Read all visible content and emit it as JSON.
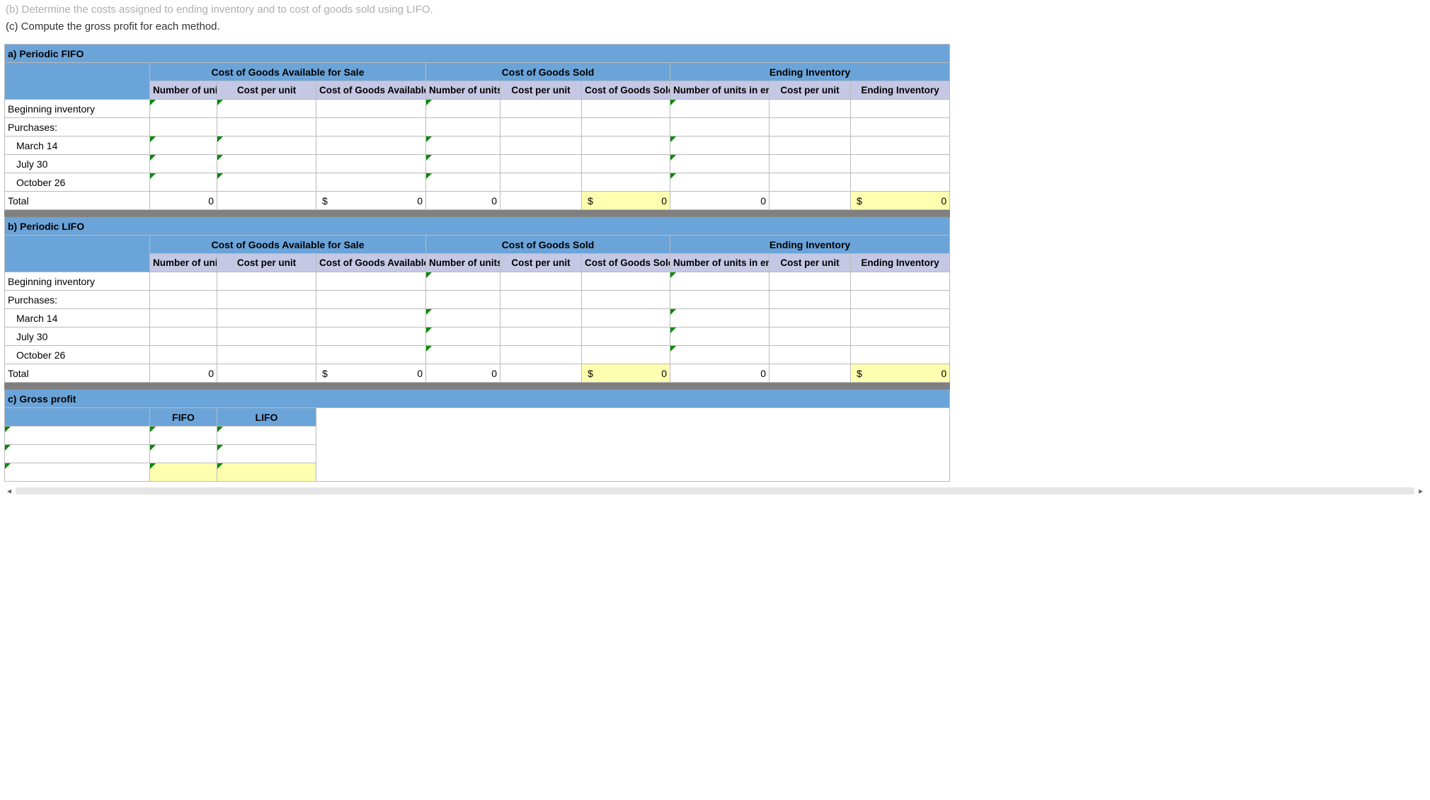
{
  "question": {
    "b_faded": "(b) Determine the costs assigned to ending inventory and to cost of goods sold using LIFO.",
    "c": "(c) Compute the gross profit for each method."
  },
  "sections": {
    "a": "a) Periodic FIFO",
    "b": "b) Periodic LIFO",
    "c": "c) Gross profit"
  },
  "groups": {
    "cogas": "Cost of Goods Available for Sale",
    "cogs": "Cost of Goods Sold",
    "ei": "Ending Inventory"
  },
  "cols": {
    "num_units": "Number of units",
    "cpu": "Cost per unit",
    "cogas": "Cost of Goods Available for Sale",
    "num_sold": "Number of units sold",
    "cogs": "Cost of Goods Sold",
    "num_end": "Number of units in ending inventory",
    "ei": "Ending Inventory"
  },
  "rows": {
    "beg": "Beginning inventory",
    "purch": "Purchases:",
    "m14": "March 14",
    "j30": "July 30",
    "o26": "October 26",
    "total": "Total"
  },
  "totals": {
    "zero": "0",
    "dollar": "$"
  },
  "gp": {
    "fifo": "FIFO",
    "lifo": "LIFO"
  }
}
